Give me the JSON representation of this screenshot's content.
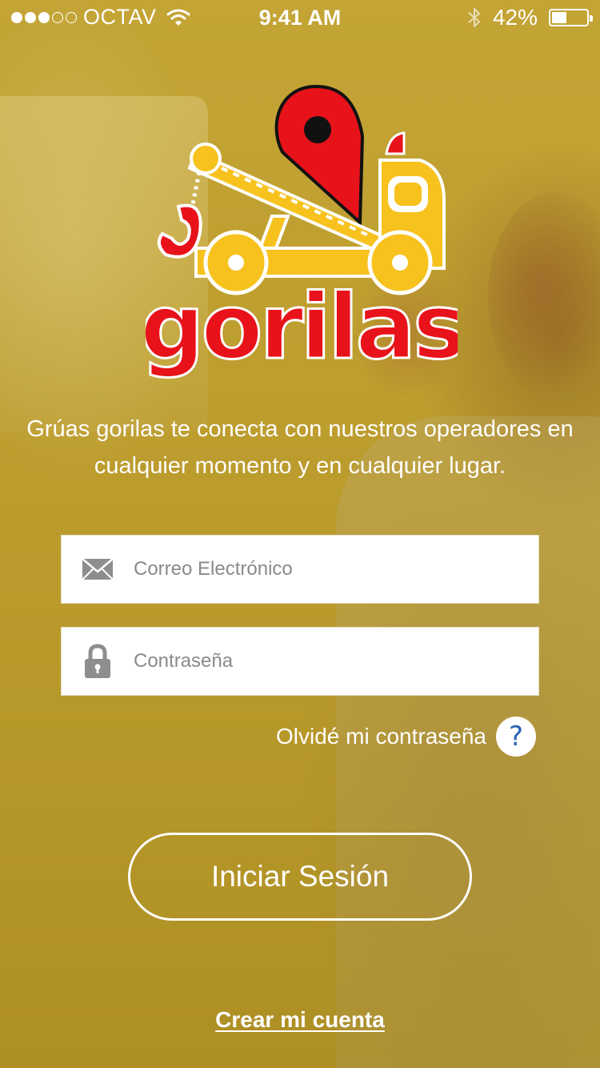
{
  "status_bar": {
    "carrier": "OCTAV",
    "time": "9:41 AM",
    "battery_percent": "42%",
    "battery_level": 0.42,
    "signal_filled": 3,
    "signal_total": 5
  },
  "logo": {
    "wordmark": "gorilas",
    "colors": {
      "red": "#e8121a",
      "yellow": "#f7c21e",
      "white": "#ffffff"
    }
  },
  "tagline": "Grúas gorilas te conecta con nuestros operadores en cualquier momento y en cualquier lugar.",
  "form": {
    "email_placeholder": "Correo Electrónico",
    "email_value": "",
    "email_icon": "envelope-icon",
    "password_placeholder": "Contraseña",
    "password_value": "",
    "password_icon": "lock-icon"
  },
  "forgot_password": {
    "label": "Olvidé mi contraseña",
    "help_glyph": "?"
  },
  "login_button": "Iniciar Sesión",
  "create_account": "Crear mi cuenta",
  "theme": {
    "overlay_color": "#bd9d2e",
    "help_icon_color": "#2b63b5"
  }
}
